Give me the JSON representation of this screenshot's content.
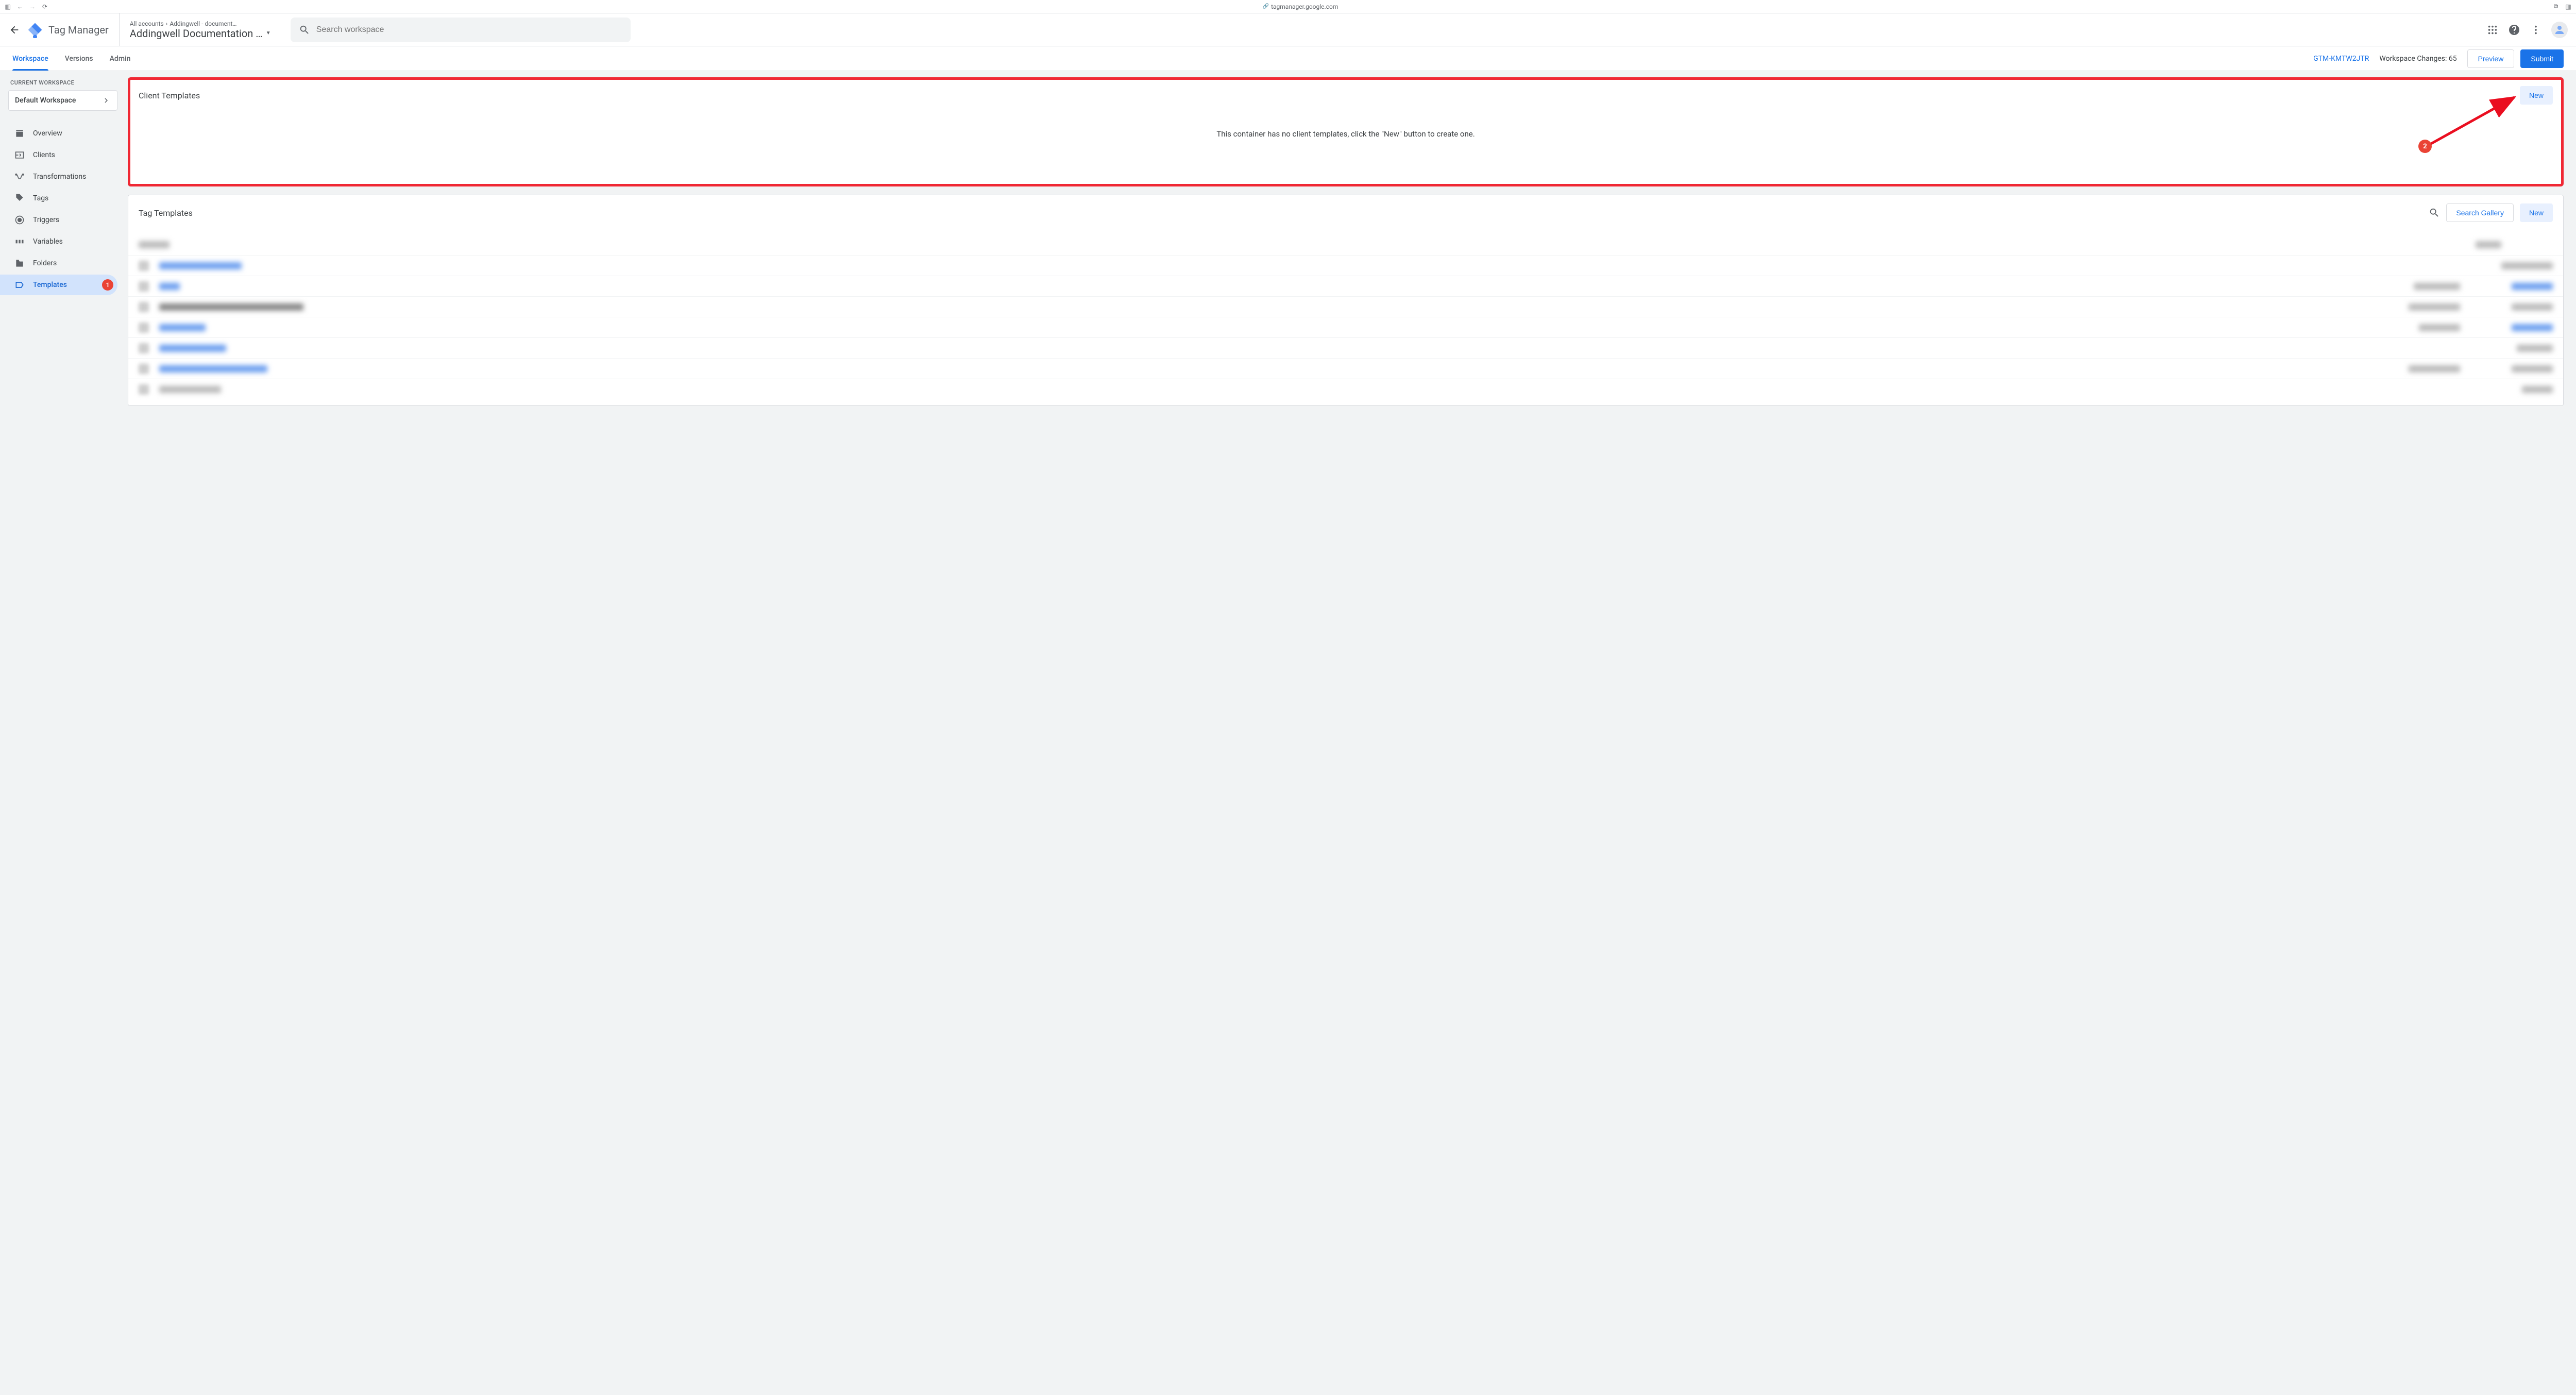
{
  "browser": {
    "url": "tagmanager.google.com"
  },
  "header": {
    "product": "Tag Manager",
    "breadcrumb_root": "All accounts",
    "breadcrumb_account": "Addingwell - document…",
    "container_name": "Addingwell Documentation …",
    "search_placeholder": "Search workspace"
  },
  "subheader": {
    "tabs": {
      "workspace": "Workspace",
      "versions": "Versions",
      "admin": "Admin"
    },
    "container_id": "GTM-KMTW2JTR",
    "workspace_changes_label": "Workspace Changes: 65",
    "preview": "Preview",
    "submit": "Submit"
  },
  "sidebar": {
    "current_workspace_label": "CURRENT WORKSPACE",
    "workspace_name": "Default Workspace",
    "items": {
      "overview": "Overview",
      "clients": "Clients",
      "transformations": "Transformations",
      "tags": "Tags",
      "triggers": "Triggers",
      "variables": "Variables",
      "folders": "Folders",
      "templates": "Templates"
    },
    "templates_badge": "1"
  },
  "panels": {
    "client_templates": {
      "title": "Client Templates",
      "new": "New",
      "empty_message": "This container has no client templates, click the \"New\" button to create one."
    },
    "tag_templates": {
      "title": "Tag Templates",
      "search_gallery": "Search Gallery",
      "new": "New"
    }
  },
  "annotations": {
    "arrow_badge": "2"
  }
}
